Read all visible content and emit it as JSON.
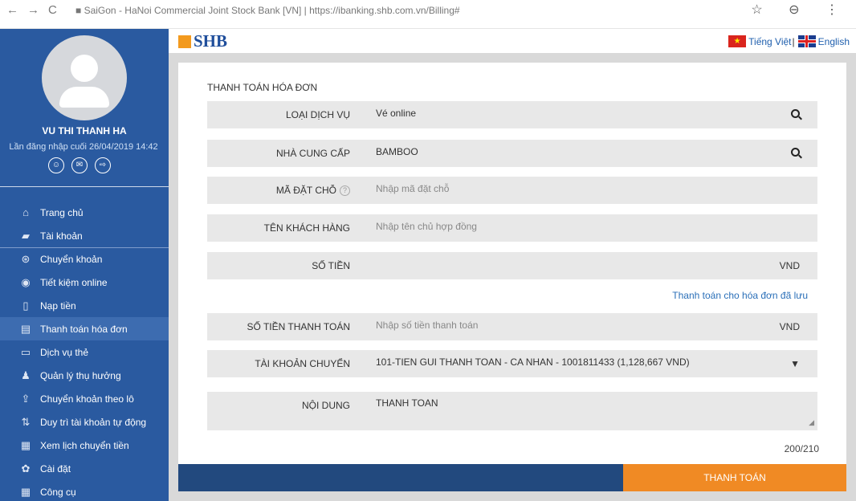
{
  "browser": {
    "nav_icons": [
      "←",
      "→",
      "C"
    ],
    "url_text": "■ SaiGon - HaNoi Commercial Joint Stock Bank [VN] | https://ibanking.shb.com.vn/Billing#",
    "right_icons": "☆ ⊖ ⋮"
  },
  "header": {
    "logo": "SHB",
    "lang_vi": "Tiếng Việt",
    "lang_sep": "|",
    "lang_en": "English"
  },
  "user": {
    "name": "VU THI THANH HA",
    "last_login": "Lần đăng nhập cuối 26/04/2019 14:42"
  },
  "menu": [
    {
      "label": "Trang chủ",
      "icon": "home-icon",
      "glyph": "⌂"
    },
    {
      "label": "Tài khoản",
      "icon": "folder-icon",
      "glyph": "▰"
    },
    {
      "label": "Chuyển khoản",
      "icon": "money-circle-icon",
      "glyph": "⊛"
    },
    {
      "label": "Tiết kiệm online",
      "icon": "piggy-bank-icon",
      "glyph": "◉"
    },
    {
      "label": "Nạp tiền",
      "icon": "phone-icon",
      "glyph": "▯"
    },
    {
      "label": "Thanh toán hóa đơn",
      "icon": "invoice-icon",
      "glyph": "▤"
    },
    {
      "label": "Dịch vụ thẻ",
      "icon": "card-icon",
      "glyph": "▭"
    },
    {
      "label": "Quản lý thụ hưởng",
      "icon": "users-icon",
      "glyph": "♟"
    },
    {
      "label": "Chuyển khoản theo lô",
      "icon": "upload-icon",
      "glyph": "⇪"
    },
    {
      "label": "Duy trì tài khoản tự động",
      "icon": "sort-arrows-icon",
      "glyph": "⇅"
    },
    {
      "label": "Xem lịch chuyển tiền",
      "icon": "calendar-icon",
      "glyph": "▦"
    },
    {
      "label": "Cài đặt",
      "icon": "gear-icon",
      "glyph": "✿"
    },
    {
      "label": "Công cụ",
      "icon": "calculator-icon",
      "glyph": "▦"
    }
  ],
  "form": {
    "title": "THANH TOÁN HÓA ĐƠN",
    "service_type": {
      "label": "Loại dịch vụ",
      "value": "Vé online"
    },
    "provider": {
      "label": "Nhà cung cấp",
      "value": "BAMBOO"
    },
    "booking_code": {
      "label": "Mã đặt chỗ",
      "placeholder": "Nhập mã đặt chỗ"
    },
    "customer_name": {
      "label": "Tên khách hàng",
      "placeholder": "Nhập tên chủ hợp đồng"
    },
    "amount": {
      "label": "Số tiền",
      "value": "",
      "currency": "VND"
    },
    "saved_bill_link": "Thanh toán cho hóa đơn đã lưu",
    "pay_amount": {
      "label": "Số tiền thanh toán",
      "placeholder": "Nhập số tiền thanh toán",
      "currency": "VND"
    },
    "source_account": {
      "label": "Tài khoản chuyển",
      "value": "101-TIEN GUI THANH TOAN - CA NHAN - 1001811433 (1,128,667 VND)"
    },
    "content": {
      "label": "Nội dung",
      "value": "THANH TOAN"
    },
    "char_counter": "200/210",
    "submit_label": "THANH TOÁN"
  },
  "colors": {
    "sidebar": "#2a5aa0",
    "accent_orange": "#f08a24",
    "footer_blue": "#22497e"
  }
}
